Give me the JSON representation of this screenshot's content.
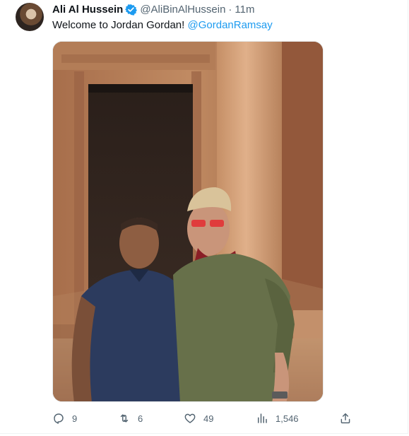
{
  "tweet": {
    "author_name": "Ali Al Hussein",
    "handle": "@AliBinAlHussein",
    "separator": "·",
    "time": "11m",
    "text": "Welcome to Jordan Gordan!",
    "mention": "@GordanRamsay"
  },
  "actions": {
    "replies": "9",
    "retweets": "6",
    "likes": "49",
    "views": "1,546"
  },
  "icons": {
    "verified": "verified-badge-icon",
    "reply": "reply-icon",
    "retweet": "retweet-icon",
    "like": "heart-icon",
    "views": "views-chart-icon",
    "share": "share-icon"
  },
  "colors": {
    "accent": "#1d9bf0",
    "text": "#0f1419",
    "muted": "#536471"
  }
}
